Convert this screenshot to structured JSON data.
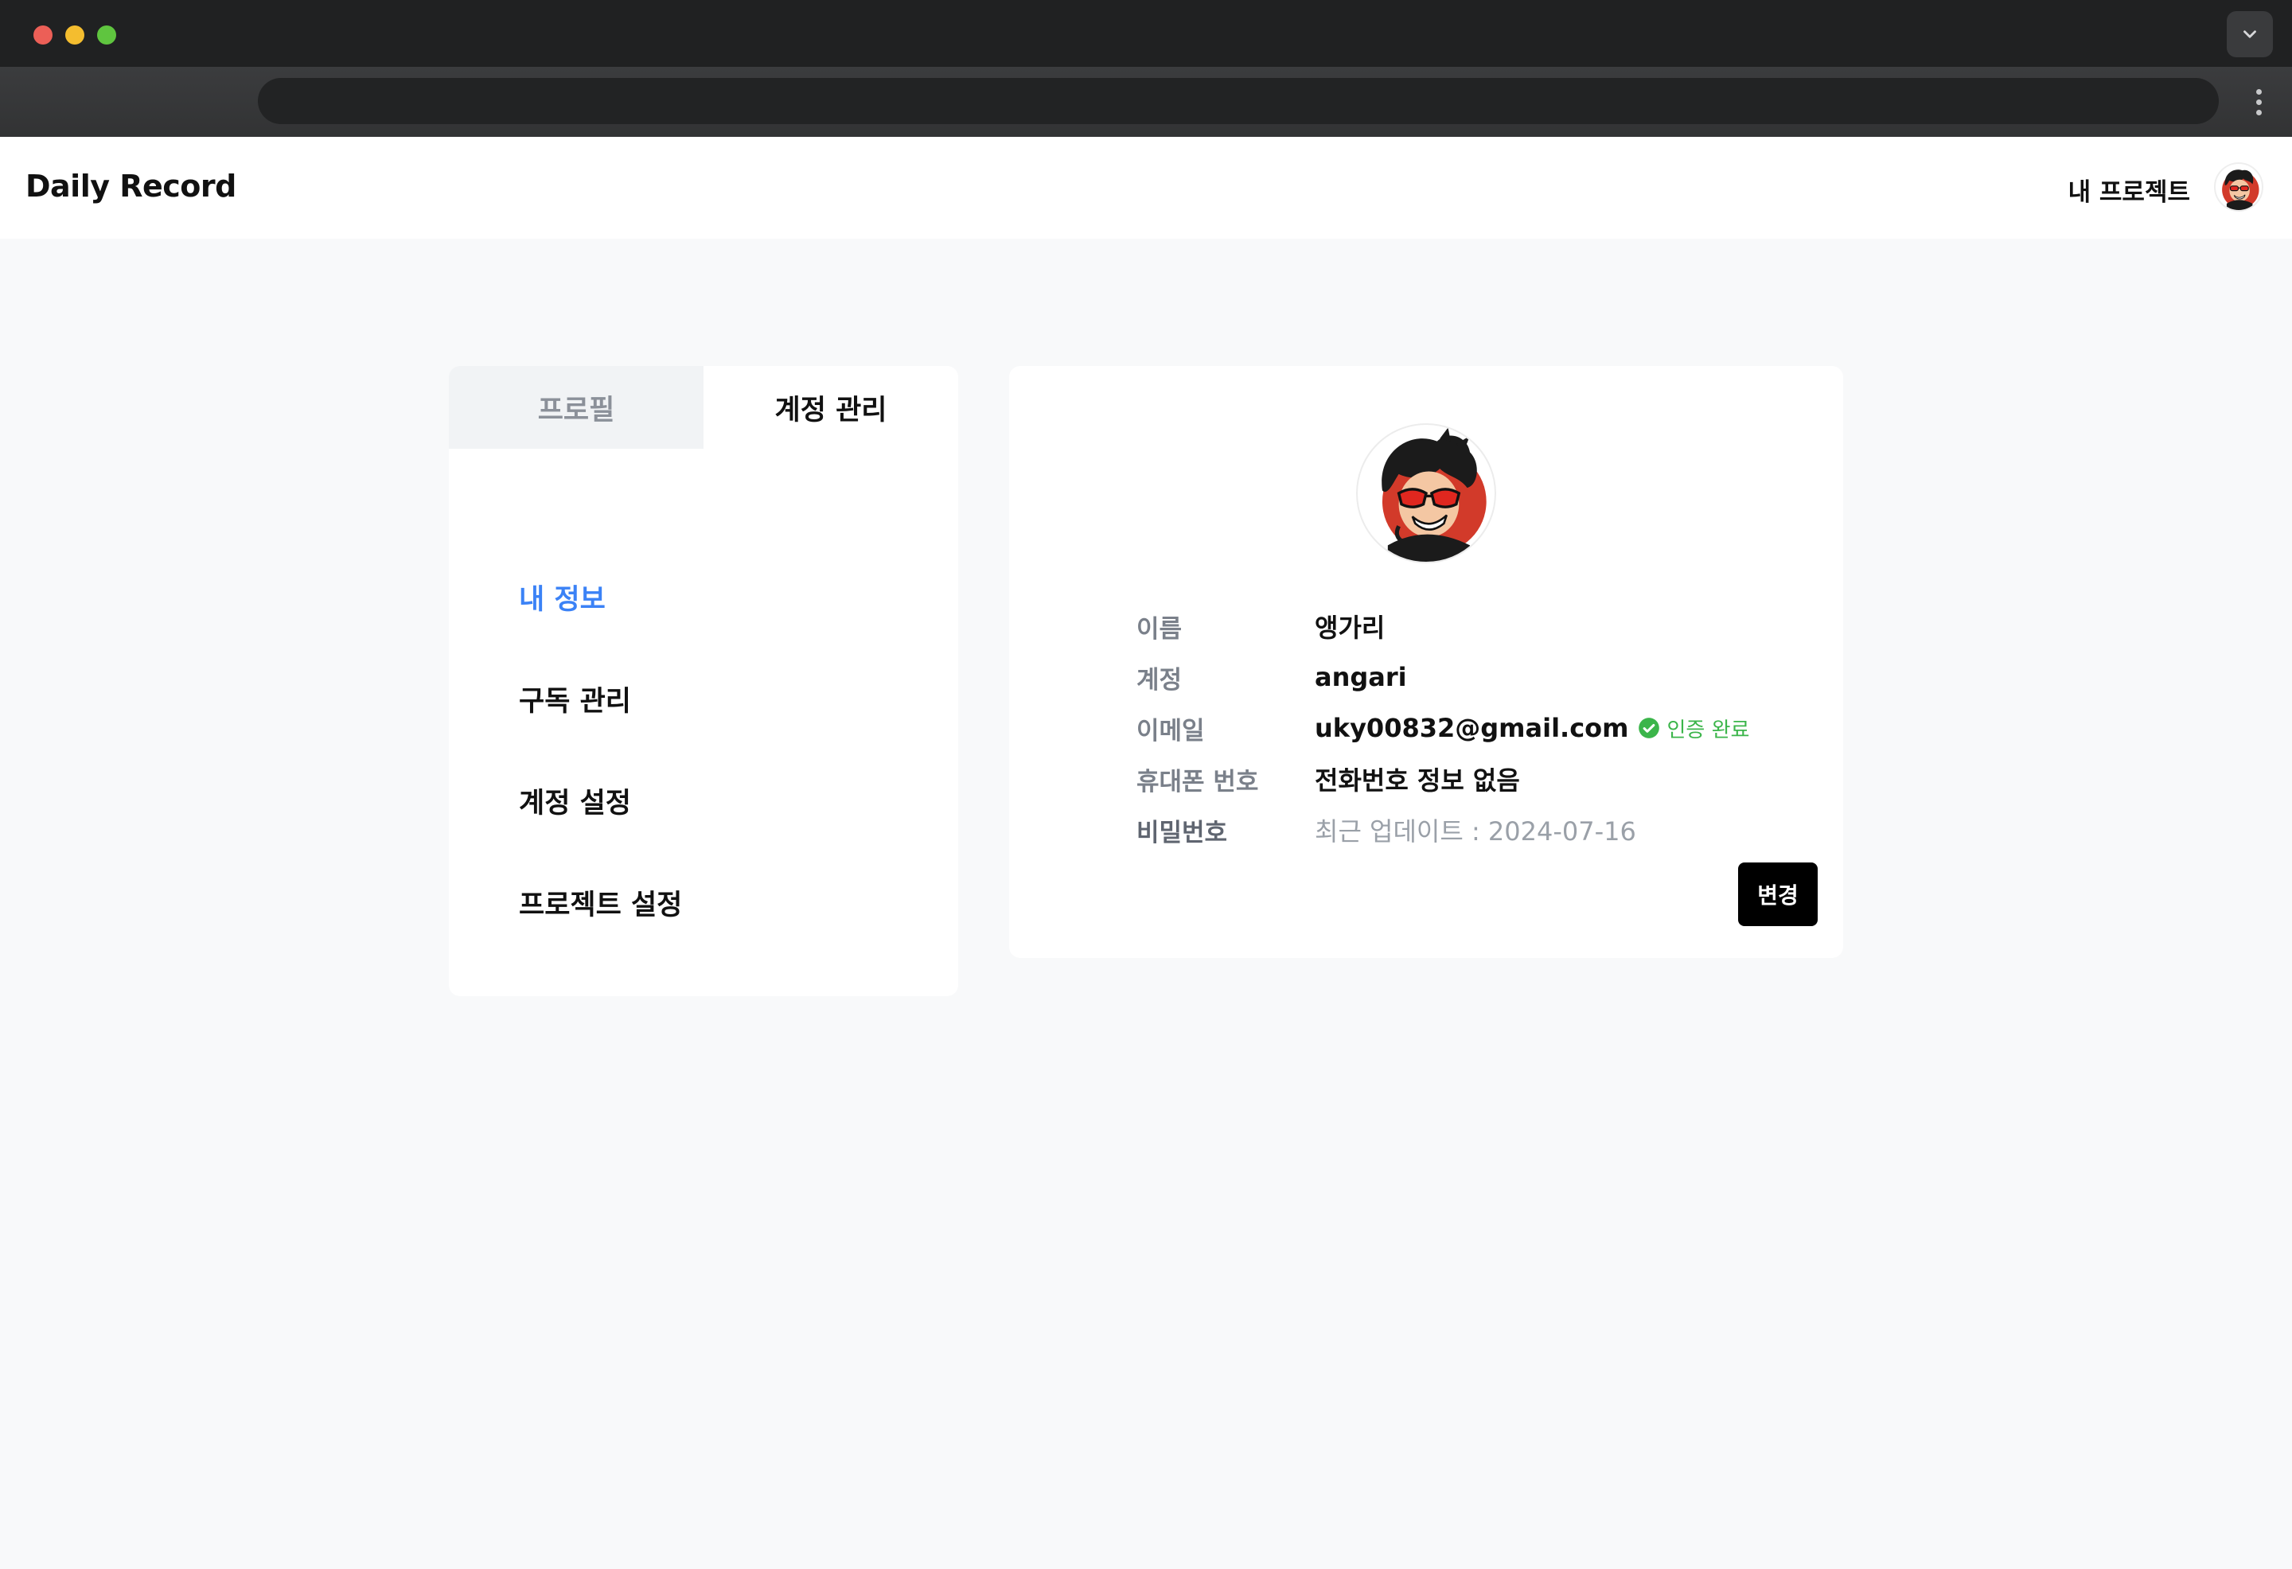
{
  "app": {
    "brand": "Daily Record",
    "nav_project": "내 프로젝트"
  },
  "tabs": [
    {
      "label": "프로필",
      "active": false
    },
    {
      "label": "계정 관리",
      "active": true
    }
  ],
  "menu": [
    {
      "label": "내 정보",
      "active": true
    },
    {
      "label": "구독 관리",
      "active": false
    },
    {
      "label": "계정 설정",
      "active": false
    },
    {
      "label": "프로젝트 설정",
      "active": false
    }
  ],
  "account": {
    "name_label": "이름",
    "name_value": "앵가리",
    "account_label": "계정",
    "account_value": "angari",
    "email_label": "이메일",
    "email_value": "uky00832@gmail.com",
    "verified_text": "인증 완료",
    "phone_label": "휴대폰 번호",
    "phone_value": "전화번호 정보 없음",
    "password_label": "비밀번호",
    "password_value": "최근 업데이트 : 2024-07-16",
    "change_button": "변경"
  },
  "colors": {
    "accent": "#3b82f6",
    "verified": "#3bb54a",
    "page_bg": "#f8f9fa"
  },
  "icons": {
    "verified": "check-circle-icon",
    "tab_dropdown": "chevron-down-icon",
    "browser_menu": "kebab-menu-icon"
  }
}
